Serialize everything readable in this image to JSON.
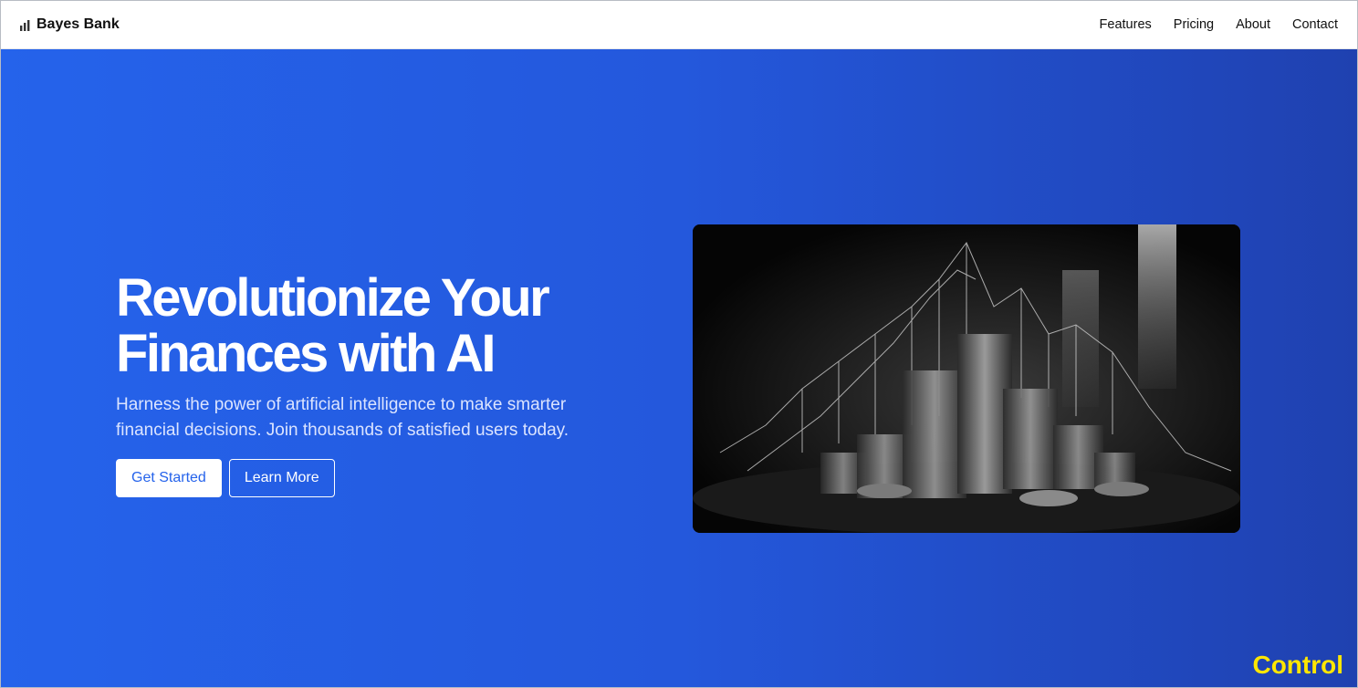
{
  "nav": {
    "brand_icon": "bar-chart-icon",
    "brand_name": "Bayes Bank",
    "links": [
      "Features",
      "Pricing",
      "About",
      "Contact"
    ]
  },
  "hero": {
    "title_line1": "Revolutionize Your",
    "title_line2": "Finances with AI",
    "subtitle_line1": "Harness the power of artificial intelligence to make smarter",
    "subtitle_line2": "financial decisions. Join thousands of satisfied users today.",
    "primary_button": "Get Started",
    "secondary_button": "Learn More",
    "background_start": "#2563eb",
    "background_end": "#1f41b0"
  },
  "overlay": {
    "label": "Control",
    "color": "#ffe600"
  }
}
